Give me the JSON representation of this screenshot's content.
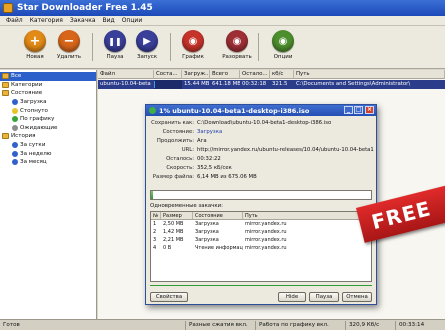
{
  "window": {
    "title": "Star Downloader Free 1.45"
  },
  "menu": [
    "Файл",
    "Категория",
    "Закачка",
    "Вид",
    "Опции"
  ],
  "toolbar": [
    {
      "label": "Новая",
      "icon": "plus-icon",
      "color": "#e28a16",
      "glyph": "+"
    },
    {
      "label": "Удалить",
      "icon": "minus-icon",
      "color": "#d8661a",
      "glyph": "−"
    },
    {
      "label": "Пауза",
      "icon": "pause-icon",
      "color": "#3a3f9a",
      "glyph": "❚❚"
    },
    {
      "label": "Запуск",
      "icon": "play-icon",
      "color": "#3a3f9a",
      "glyph": "▶"
    },
    {
      "label": "График",
      "icon": "schedule-icon",
      "color": "#c5332b",
      "glyph": "◉"
    },
    {
      "label": "Разорвать",
      "icon": "disconnect-icon",
      "color": "#9d2f35",
      "glyph": "◉"
    },
    {
      "label": "Опции",
      "icon": "options-icon",
      "color": "#4d8f2c",
      "glyph": "◉"
    }
  ],
  "sidebar": [
    {
      "label": "Все",
      "icon": "folder",
      "indent": 0,
      "selected": true
    },
    {
      "label": "Категории",
      "icon": "folder",
      "indent": 0
    },
    {
      "label": "Состояние",
      "icon": "folder",
      "indent": 0
    },
    {
      "label": "Загрузка",
      "icon": "dot-blue",
      "indent": 1
    },
    {
      "label": "Стопнуто",
      "icon": "dot-yellow",
      "indent": 1
    },
    {
      "label": "По графику",
      "icon": "dot-green",
      "indent": 1
    },
    {
      "label": "Ожидающие",
      "icon": "dot-gray",
      "indent": 1
    },
    {
      "label": "История",
      "icon": "folder",
      "indent": 0
    },
    {
      "label": "За сутки",
      "icon": "dot-blue",
      "indent": 1
    },
    {
      "label": "За неделю",
      "icon": "dot-blue",
      "indent": 1
    },
    {
      "label": "За месяц",
      "icon": "dot-blue",
      "indent": 1
    }
  ],
  "main": {
    "columns": [
      "Файл",
      "Соста...",
      "Загруж...",
      "Всего",
      "Остало...",
      "кб/с",
      "Путь"
    ],
    "row": {
      "file": "ubuntu-10.04-beta",
      "progress": 0.01,
      "downloaded": "15.44 MB",
      "total": "641.18 MB",
      "remaining": "00:32:18",
      "speed": "321.5",
      "path": "C:\\Documents and Settings\\Administrator\\"
    }
  },
  "dialog": {
    "title": "1% ubuntu-10.04-beta1-desktop-i386.iso",
    "saved_as_key": "Сохранить как:",
    "saved_as": "C:\\Download\\ubuntu-10.04-beta1-desktop-i386.iso",
    "state_key": "Состояние:",
    "state": "Загрузка",
    "resume_key": "Продолжить:",
    "resume": "Ага",
    "url_key": "URL:",
    "url": "http://mirror.yandex.ru/ubuntu-releases/10.04/ubuntu-10.04-beta1",
    "left_key": "Осталось:",
    "left": "00:32:22",
    "speed_key": "Скорость:",
    "speed": "352,5 кБ/сек",
    "size_key": "Размер файла:",
    "size": "6,14 MB из 675.06 MB",
    "progress": 0.01,
    "connections_label": "Одновременные закачки:",
    "conn_columns": [
      "№",
      "Размер",
      "Состояние",
      "Путь"
    ],
    "connections": [
      {
        "n": "1",
        "size": "2,50 MB",
        "state": "Загрузка",
        "path": "mirror.yandex.ru"
      },
      {
        "n": "2",
        "size": "1,42 MB",
        "state": "Загрузка",
        "path": "mirror.yandex.ru"
      },
      {
        "n": "3",
        "size": "2,21 MB",
        "state": "Загрузка",
        "path": "mirror.yandex.ru"
      },
      {
        "n": "4",
        "size": "0 B",
        "state": "Чтение информации",
        "path": "mirror.yandex.ru"
      }
    ],
    "buttons": {
      "props": "Свойства",
      "hide": "Hide",
      "pause": "Пауза",
      "cancel": "Отмена"
    }
  },
  "status": {
    "ready": "Готов",
    "mode": "Разные сжатия вкл.",
    "schedule": "Работа по графику вкл.",
    "speed": "320,9 Кб/с",
    "time": "00:33:14"
  },
  "badge": "FREE"
}
